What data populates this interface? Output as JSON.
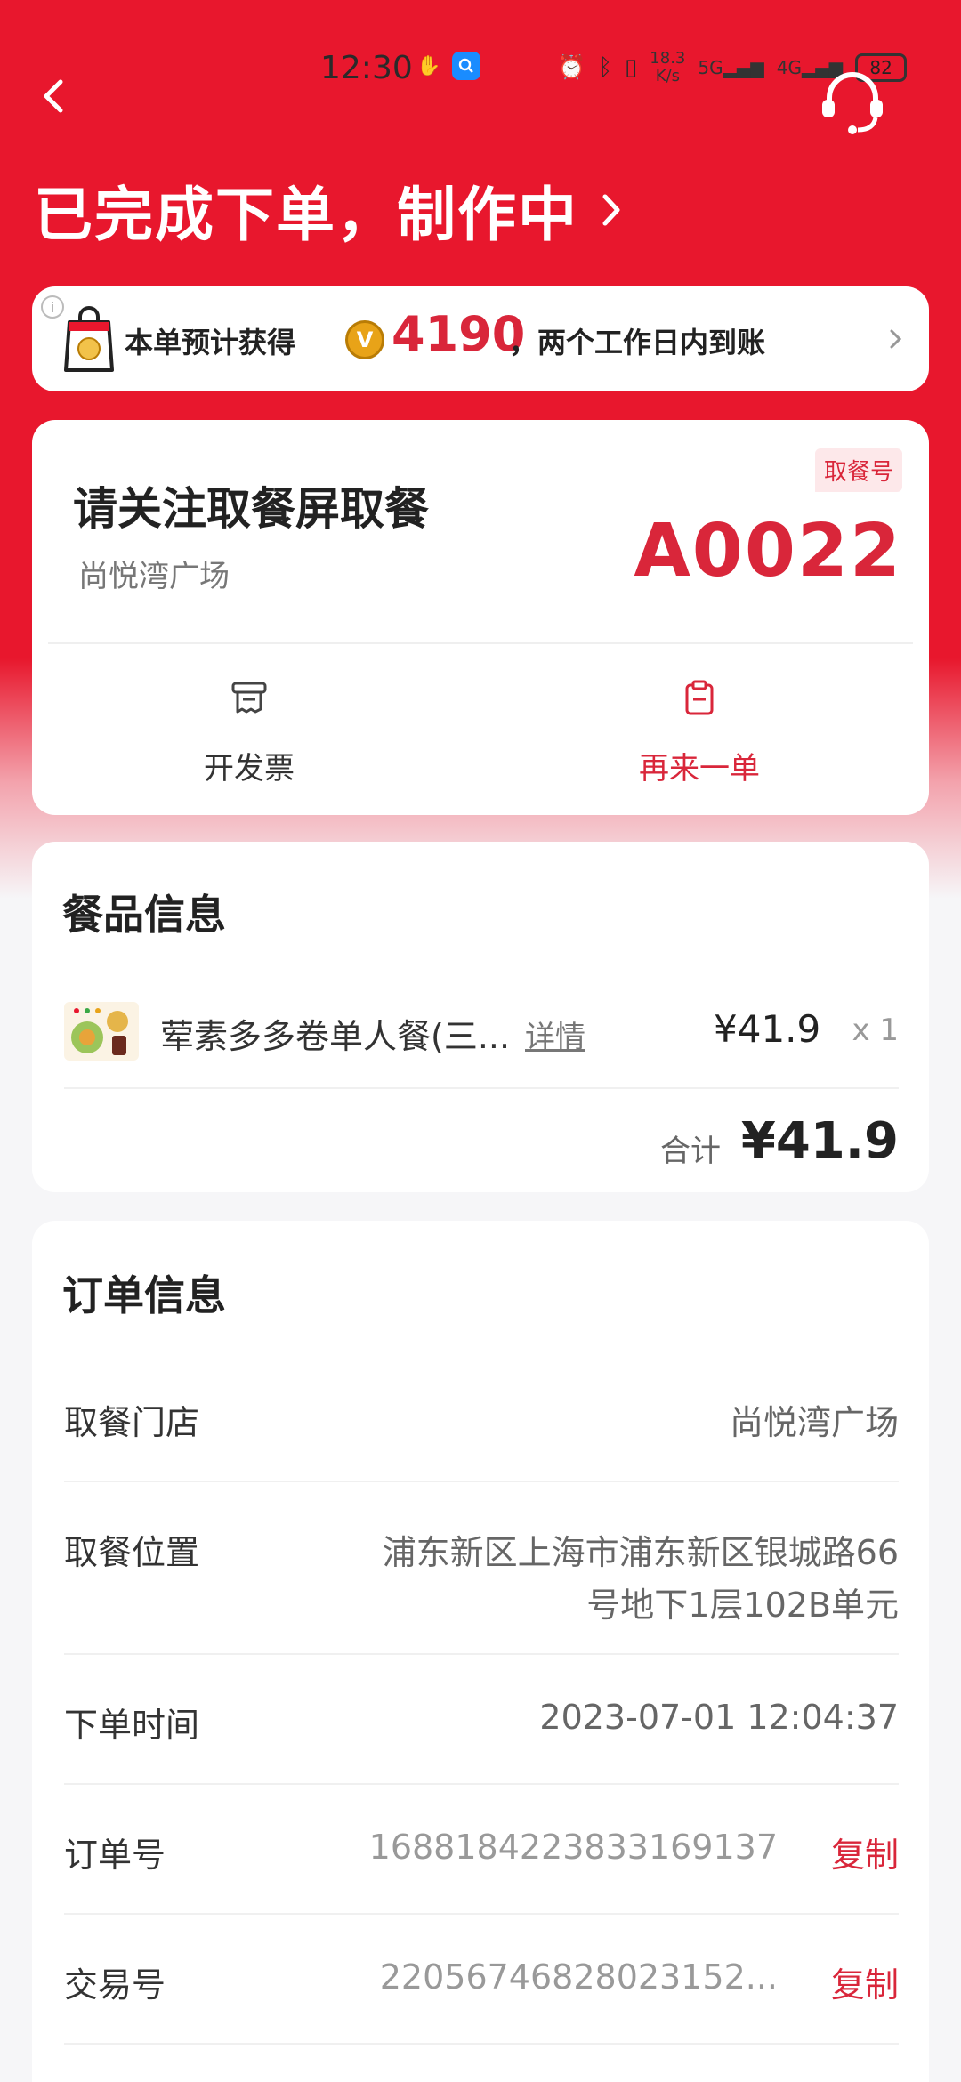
{
  "status_bar": {
    "time": "12:30",
    "speed_value": "18.3",
    "speed_unit": "K/s",
    "net_5g": "5G",
    "net_4g": "4G",
    "battery": "82"
  },
  "header": {
    "title": "已完成下单，制作中"
  },
  "reward": {
    "prefix": "本单预计获得",
    "coin_letter": "V",
    "points": "4190",
    "suffix": "，两个工作日内到账"
  },
  "pickup": {
    "heading": "请关注取餐屏取餐",
    "store": "尚悦湾广场",
    "tag": "取餐号",
    "code": "A0022",
    "actions": [
      {
        "label": "开发票",
        "icon": "receipt-icon"
      },
      {
        "label": "再来一单",
        "icon": "clipboard-icon"
      }
    ]
  },
  "food": {
    "title": "餐品信息",
    "item": {
      "name": "荤素多多卷单人餐(三...",
      "detail_link": "详情",
      "price": "¥41.9",
      "qty": "x 1"
    },
    "total_label": "合计",
    "total": "¥41.9"
  },
  "order": {
    "title": "订单信息",
    "rows": [
      {
        "key": "取餐门店",
        "value": "尚悦湾广场"
      },
      {
        "key": "取餐位置",
        "value_line1": "浦东新区上海市浦东新区银城路66",
        "value_line2": "号地下1层102B单元"
      },
      {
        "key": "下单时间",
        "value": "2023-07-01 12:04:37"
      },
      {
        "key": "订单号",
        "value": "1688184223833169137",
        "action": "复制"
      },
      {
        "key": "交易号",
        "value": "22056746828023152...",
        "action": "复制"
      }
    ]
  },
  "colors": {
    "brand_red": "#e8172d",
    "accent_red": "#d9263a"
  }
}
